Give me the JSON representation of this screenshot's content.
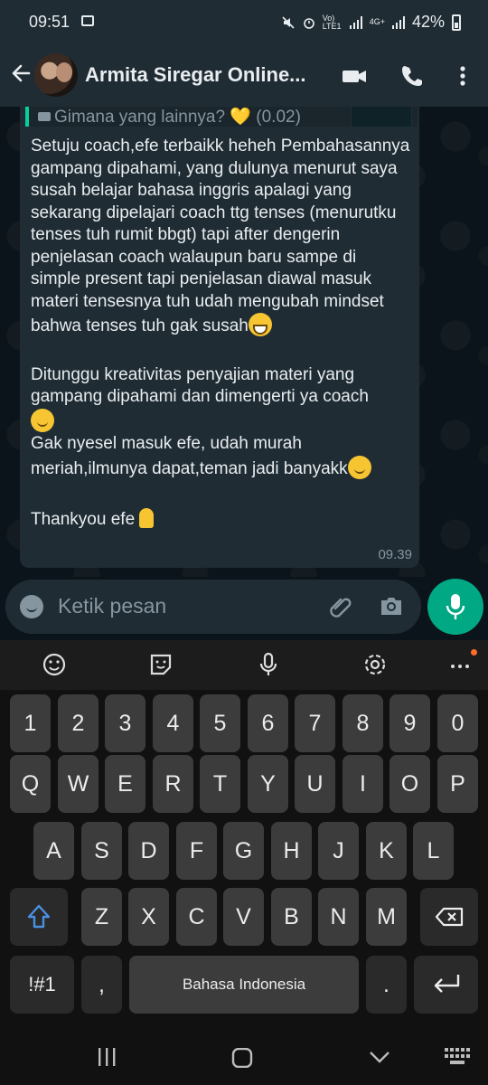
{
  "status_bar": {
    "time": "09:51",
    "network_label": "Vo) LTE1",
    "data_label": "4G+",
    "battery": "42%"
  },
  "header": {
    "contact_name": "Armita Siregar Online..."
  },
  "message": {
    "quote_text": "Gimana yang lainnya? 💛 (0.02)",
    "paragraph1": "Setuju coach,efe terbaikk heheh Pembahasannya gampang dipahami, yang dulunya menurut saya susah belajar bahasa inggris apalagi yang sekarang dipelajari coach ttg tenses (menurutku tenses tuh rumit bbgt) tapi after dengerin penjelasan coach walaupun baru sampe di simple present tapi penjelasan diawal masuk materi tensesnya tuh udah mengubah mindset bahwa tenses tuh gak susah",
    "paragraph2": "Ditunggu kreativitas penyajian materi yang gampang dipahami dan dimengerti ya coach",
    "paragraph3": "Gak nyesel masuk efe, udah murah meriah,ilmunya dapat,teman jadi banyakk",
    "paragraph4": "Thankyou efe",
    "time": "09.39"
  },
  "input": {
    "placeholder": "Ketik pesan"
  },
  "keyboard": {
    "row_numbers": [
      "1",
      "2",
      "3",
      "4",
      "5",
      "6",
      "7",
      "8",
      "9",
      "0"
    ],
    "row_q": [
      "Q",
      "W",
      "E",
      "R",
      "T",
      "Y",
      "U",
      "I",
      "O",
      "P"
    ],
    "row_a": [
      "A",
      "S",
      "D",
      "F",
      "G",
      "H",
      "J",
      "K",
      "L"
    ],
    "row_z": [
      "Z",
      "X",
      "C",
      "V",
      "B",
      "N",
      "M"
    ],
    "symbols_key": "!#1",
    "comma_key": ",",
    "space_label": "Bahasa Indonesia",
    "period_key": "."
  },
  "colors": {
    "accent": "#00a884",
    "bubble": "#1f2c34",
    "background": "#0b141a"
  }
}
